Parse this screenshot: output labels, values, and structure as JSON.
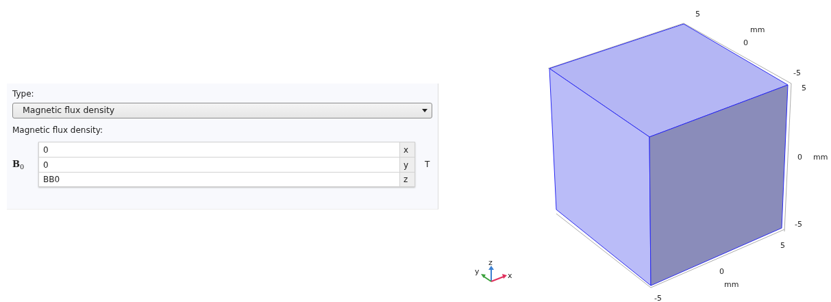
{
  "settings": {
    "type_label": "Type:",
    "type_select": {
      "value": "Magnetic flux density"
    },
    "field_label": "Magnetic flux density:",
    "vector": {
      "symbol": "**B**$_{0}$",
      "unit": "T",
      "components": [
        {
          "value": "0",
          "axis": "x"
        },
        {
          "value": "0",
          "axis": "y"
        },
        {
          "value": "BB0",
          "axis": "z"
        }
      ]
    }
  },
  "graphics": {
    "axis_labels": [
      "5",
      "mm",
      "0",
      "-5",
      "5",
      "0",
      "mm",
      "-5",
      "5",
      "0",
      "mm",
      "-5"
    ],
    "triad": [
      "x",
      "y",
      "z"
    ]
  }
}
